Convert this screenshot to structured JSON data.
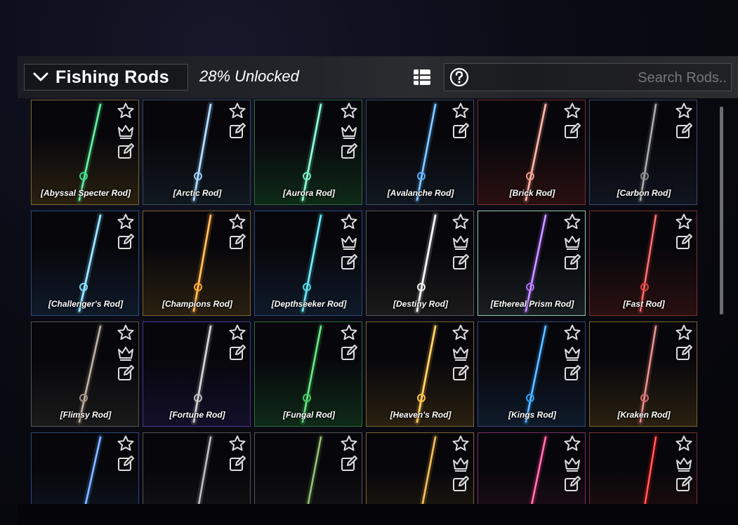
{
  "header": {
    "category_title": "Fishing Rods",
    "unlocked_text": "28% Unlocked",
    "search_placeholder": "Search Rods.."
  },
  "rods": [
    {
      "name": "[Abyssal Specter Rod]",
      "color": "#3ddc84",
      "border": "#7a6630",
      "bg": "#2a2010",
      "icons": [
        "star",
        "crown",
        "edit"
      ]
    },
    {
      "name": "[Arctic Rod]",
      "color": "#9ad0ff",
      "border": "#3a4a5a",
      "bg": "#101820",
      "icons": [
        "star",
        "edit"
      ]
    },
    {
      "name": "[Aurora Rod]",
      "color": "#6ff0c0",
      "border": "#2a6a3a",
      "bg": "#0f2a18",
      "icons": [
        "star",
        "crown",
        "edit"
      ]
    },
    {
      "name": "[Avalanche Rod]",
      "color": "#5ab0ff",
      "border": "#3a4a5a",
      "bg": "#101820",
      "icons": [
        "star",
        "edit"
      ]
    },
    {
      "name": "[Brick Rod]",
      "color": "#f09a8a",
      "border": "#7a3030",
      "bg": "#2a1010",
      "icons": [
        "star",
        "edit"
      ]
    },
    {
      "name": "[Carbon Rod]",
      "color": "#888888",
      "border": "#3a4a6a",
      "bg": "#10151f",
      "icons": [
        "star",
        "edit"
      ]
    },
    {
      "name": "[Challenger's Rod]",
      "color": "#7fdcff",
      "border": "#2f4a7a",
      "bg": "#0f1a2a",
      "icons": [
        "star",
        "edit"
      ]
    },
    {
      "name": "[Champions Rod]",
      "color": "#ffa630",
      "border": "#7a6630",
      "bg": "#2a2010",
      "icons": [
        "star",
        "edit"
      ]
    },
    {
      "name": "[Depthseeker Rod]",
      "color": "#4ad8e8",
      "border": "#2f4a7a",
      "bg": "#0f1a2a",
      "icons": [
        "star",
        "crown",
        "edit"
      ]
    },
    {
      "name": "[Destiny Rod]",
      "color": "#f2f2f2",
      "border": "#555555",
      "bg": "#1a1a1a",
      "icons": [
        "star",
        "crown",
        "edit"
      ]
    },
    {
      "name": "[Ethereal Prism Rod]",
      "color": "#b070ff",
      "border": "#8fc9a8",
      "bg": "#1a1f22",
      "icons": [
        "star",
        "crown",
        "edit"
      ]
    },
    {
      "name": "[Fast Rod]",
      "color": "#e04040",
      "border": "#7a3030",
      "bg": "#2a1010",
      "icons": [
        "star",
        "edit"
      ]
    },
    {
      "name": "[Flimsy Rod]",
      "color": "#a09080",
      "border": "#555555",
      "bg": "#1a1a1a",
      "icons": [
        "star",
        "crown",
        "edit"
      ]
    },
    {
      "name": "[Fortune Rod]",
      "color": "#c0c0c0",
      "border": "#4a3a8a",
      "bg": "#140f2a",
      "icons": [
        "star",
        "edit"
      ]
    },
    {
      "name": "[Fungal Rod]",
      "color": "#40d060",
      "border": "#2a6a3a",
      "bg": "#0f2a18",
      "icons": [
        "star",
        "edit"
      ]
    },
    {
      "name": "[Heaven's Rod]",
      "color": "#ffc040",
      "border": "#7a6630",
      "bg": "#2a2010",
      "icons": [
        "star",
        "crown",
        "edit"
      ]
    },
    {
      "name": "[Kings Rod]",
      "color": "#30a0ff",
      "border": "#2f4a7a",
      "bg": "#0f1a2a",
      "icons": [
        "star",
        "crown",
        "edit"
      ]
    },
    {
      "name": "[Kraken Rod]",
      "color": "#d06a6a",
      "border": "#7a6630",
      "bg": "#2a2010",
      "icons": [
        "star",
        "edit"
      ]
    },
    {
      "name": "",
      "color": "#5a9aff",
      "border": "#2f4a7a",
      "bg": "#0f1a2a",
      "icons": [
        "star",
        "edit"
      ]
    },
    {
      "name": "",
      "color": "#a0a0a0",
      "border": "#555555",
      "bg": "#1a1a1a",
      "icons": [
        "star",
        "edit"
      ]
    },
    {
      "name": "",
      "color": "#70a050",
      "border": "#555555",
      "bg": "#1a1a1a",
      "icons": [
        "star",
        "edit"
      ]
    },
    {
      "name": "",
      "color": "#e0a030",
      "border": "#7a6630",
      "bg": "#2a2010",
      "icons": [
        "star",
        "crown",
        "edit"
      ]
    },
    {
      "name": "",
      "color": "#ff4090",
      "border": "#7a3060",
      "bg": "#2a1020",
      "icons": [
        "star",
        "crown",
        "edit"
      ]
    },
    {
      "name": "",
      "color": "#ff2020",
      "border": "#7a3030",
      "bg": "#2a1010",
      "icons": [
        "star",
        "crown",
        "edit"
      ]
    }
  ]
}
